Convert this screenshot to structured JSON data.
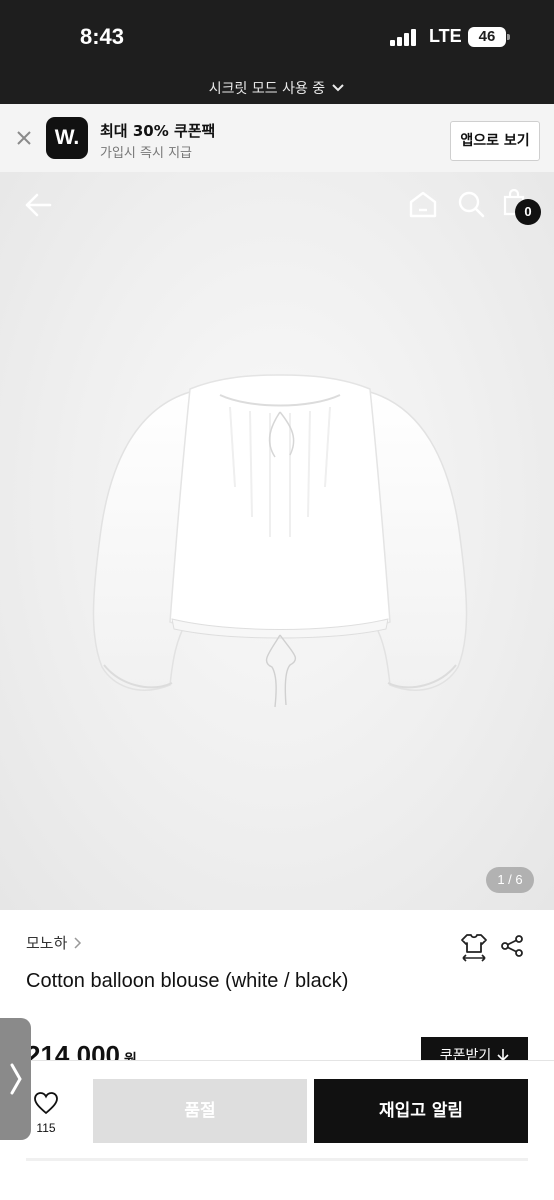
{
  "status_bar": {
    "time": "8:43",
    "network": "LTE",
    "battery": "46"
  },
  "secret_mode": {
    "label": "시크릿 모드 사용 중"
  },
  "app_banner": {
    "logo": "W.",
    "title": "최대 30% 쿠폰팩",
    "subtitle": "가입시 즉시 지급",
    "button": "앱으로 보기"
  },
  "header": {
    "cart_count": "0"
  },
  "gallery": {
    "pager": "1 / 6"
  },
  "product": {
    "brand": "모노하",
    "name": "Cotton balloon blouse (white / black)",
    "price": "214,000",
    "price_unit": "원",
    "coupon_label": "쿠폰받기"
  },
  "bottom": {
    "like_count": "115",
    "soldout_label": "품절",
    "restock_label": "재입고 알림"
  },
  "colors": {
    "dark": "#1e1e1e",
    "primary": "#111111",
    "disabled": "#dedede"
  },
  "icons": [
    "close-icon",
    "back-arrow-icon",
    "home-icon",
    "search-icon",
    "shopping-bag-icon",
    "size-guide-icon",
    "share-icon",
    "heart-icon",
    "download-icon",
    "chevron-right-icon",
    "chevron-down-icon"
  ]
}
